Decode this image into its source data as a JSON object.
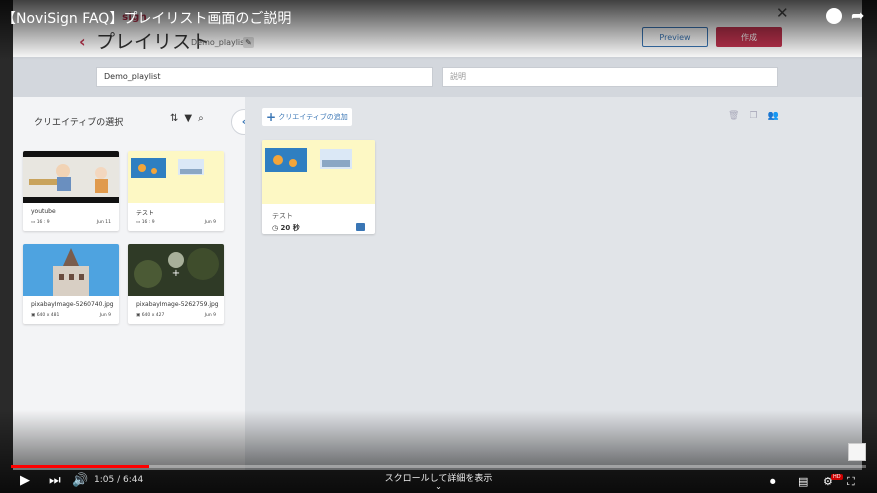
{
  "video": {
    "title": "【NoviSign FAQ】プレイリスト画面のご説明",
    "time_display": "1:05 / 6:44",
    "progress_fraction": 0.161,
    "scroll_hint": "スクロールして詳細を表示",
    "hd_label": "HD"
  },
  "app": {
    "logo_text_novi": "novi",
    "logo_text_sign": "sign",
    "back_icon": "chevron-left-icon",
    "page_title": "プレイリスト",
    "playlist_name": "Demo_playlist *",
    "preview_label": "Preview",
    "create_label": "作成",
    "name_field_value": "Demo_playlist",
    "desc_field_placeholder": "説明"
  },
  "left_panel": {
    "title": "クリエイティブの選択",
    "tools": [
      "sort-icon",
      "filter-icon",
      "search-icon"
    ],
    "cards": [
      {
        "name": "youtube",
        "meta": "16 : 9",
        "date": "Jun 11",
        "thumb": "video"
      },
      {
        "name": "テスト",
        "meta": "16 : 9",
        "date": "Jun 9",
        "thumb": "yellow"
      },
      {
        "name": "pixabayImage-5260740.jpg",
        "meta": "640 x 481",
        "date": "Jun 9",
        "thumb": "building"
      },
      {
        "name": "pixabayImage-5262759.jpg",
        "meta": "640 x 427",
        "date": "Jun 9",
        "thumb": "forest"
      }
    ]
  },
  "right_area": {
    "add_label": "クリエイティブの追加",
    "tools": [
      "trash-icon",
      "copy-icon",
      "people-icon"
    ],
    "playlist_item": {
      "name": "テスト",
      "duration": "20 秒"
    }
  },
  "colors": {
    "brand_red": "#c2334f",
    "accent_blue": "#3a76b5",
    "progress_red": "#ff0000"
  }
}
